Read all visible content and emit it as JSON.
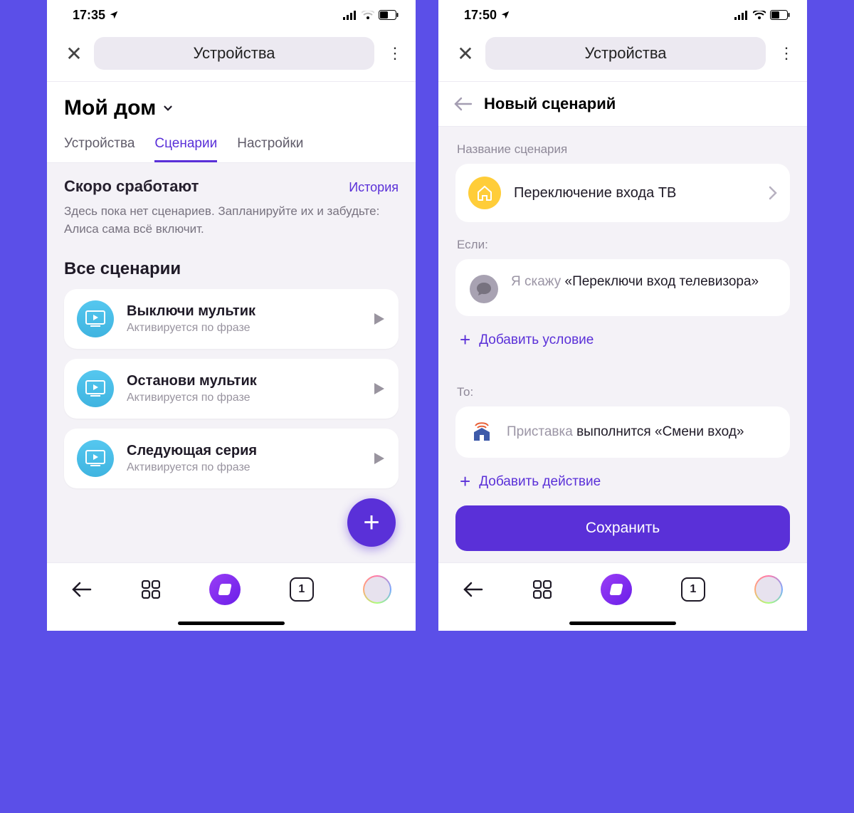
{
  "left": {
    "status": {
      "time": "17:35"
    },
    "topbar": {
      "title": "Устройства"
    },
    "home_title": "Мой дом",
    "tabs": {
      "devices": "Устройства",
      "scenarios": "Сценарии",
      "settings": "Настройки"
    },
    "soon": {
      "title": "Скоро сработают",
      "history": "История",
      "desc": "Здесь пока нет сценариев. Запланируйте их и забудьте: Алиса сама всё включит."
    },
    "all_title": "Все сценарии",
    "items": [
      {
        "title": "Выключи мультик",
        "sub": "Активируется по фразе"
      },
      {
        "title": "Останови мультик",
        "sub": "Активируется по фразе"
      },
      {
        "title": "Следующая серия",
        "sub": "Активируется по фразе"
      }
    ],
    "nav_badge": "1"
  },
  "right": {
    "status": {
      "time": "17:50"
    },
    "topbar": {
      "title": "Устройства"
    },
    "subheader": "Новый сценарий",
    "name_label": "Название сценария",
    "name_value": "Переключение входа ТВ",
    "if_label": "Если:",
    "if_gray": "Я скажу ",
    "if_bold": "«Переключи вход телевизора»",
    "add_condition": "Добавить условие",
    "then_label": "То:",
    "then_gray": "Приставка ",
    "then_bold": "выполнится «Смени вход»",
    "add_action": "Добавить действие",
    "save": "Сохранить",
    "nav_badge": "1"
  }
}
